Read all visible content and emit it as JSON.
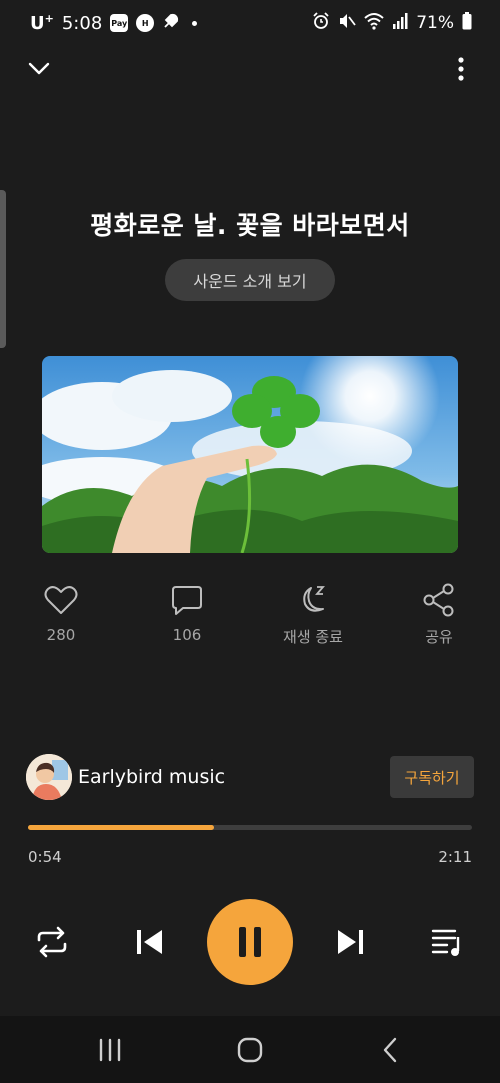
{
  "status_bar": {
    "carrier": "U",
    "carrier_sup": "+",
    "time": "5:08",
    "badge_pay": "Pay",
    "badge_h": "H",
    "battery": "71%"
  },
  "track": {
    "title": "평화로운 날. 꽃을 바라보면서",
    "intro_button": "사운드 소개 보기"
  },
  "actions": {
    "like_count": "280",
    "comment_count": "106",
    "sleep_label": "재생 종료",
    "share_label": "공유"
  },
  "channel": {
    "name": "Earlybird music",
    "subscribe_label": "구독하기"
  },
  "player": {
    "progress_fraction": 0.418,
    "current_time": "0:54",
    "total_time": "2:11"
  },
  "colors": {
    "accent": "#f5a53c",
    "background": "#1c1c1c"
  }
}
